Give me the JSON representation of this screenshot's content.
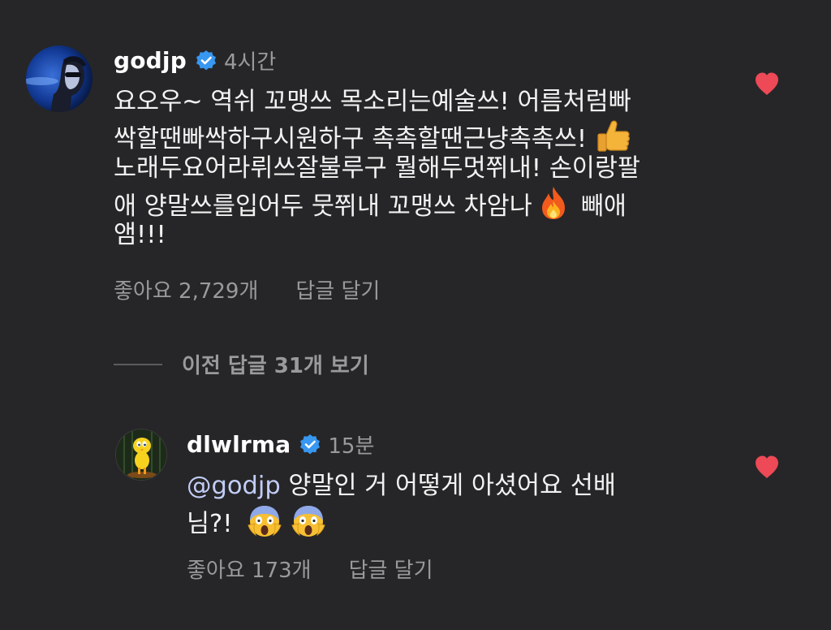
{
  "comments": [
    {
      "username": "godjp",
      "time": "4시간",
      "lines": [
        "요오우~ 역쉬 꼬맹쓰 목소리는예술쓰! 어름처럼빠",
        "싹할땐빠싹하구시원하구 촉촉할땐근냥촉촉쓰!",
        "노래두요어라뤼쓰잘불루구 뭘해두멋쮜내! 손이랑팔",
        "애 양말쓰를입어두 뭇쮜내 꼬맹쓰 차암나",
        "빼애",
        "앰!!!"
      ],
      "emojis": [
        "thumbs-up",
        "fire"
      ],
      "likes": "좋아요 2,729개",
      "reply": "답글 달기",
      "liked": true
    },
    {
      "username": "dlwlrma",
      "time": "15분",
      "mention": "@godjp",
      "lines": [
        "양말인 거 어떻게 아셨어요 선배",
        "님?!"
      ],
      "emojis": [
        "face-screaming-in-fear",
        "face-screaming-in-fear"
      ],
      "likes": "좋아요 173개",
      "reply": "답글 달기",
      "liked": true
    }
  ],
  "view_replies": "이전 답글 31개 보기",
  "colors": {
    "background": "#262628",
    "heart": "#ed4956",
    "verified": "#3897f0",
    "secondary_text": "#9a9a9c",
    "mention": "#c2cdf6"
  }
}
